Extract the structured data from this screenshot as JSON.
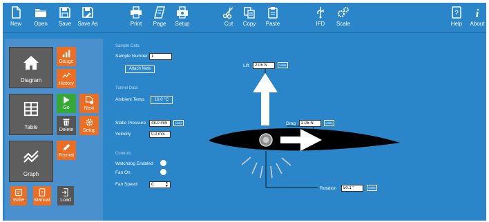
{
  "toolbar": {
    "new": "New",
    "open": "Open",
    "save": "Save",
    "save_as": "Save As",
    "print": "Print",
    "page": "Page",
    "setup": "Setup",
    "cut": "Cut",
    "copy": "Copy",
    "paste": "Paste",
    "ifd": "IFD",
    "scale": "Scale",
    "help": "Help",
    "about": "About"
  },
  "tiles": {
    "diagram": "Diagram",
    "gauge": "Gauge",
    "history": "History",
    "table": "Table",
    "go": "Go",
    "next": "Next",
    "delete": "Delete",
    "setup": "Setup",
    "graph": "Graph",
    "format": "Format",
    "write": "Write",
    "manual": "Manual",
    "load": "Load"
  },
  "sample": {
    "section": "Sample Data",
    "number_label": "Sample Number",
    "number_value": "1",
    "attach_note": "Attach Note"
  },
  "tunnel": {
    "section": "Tunnel Data",
    "ambient_label": "Ambient Temp.",
    "ambient_value": "18.0 °C"
  },
  "pressure": {
    "static_label": "Static Pressure",
    "static_value": "48.0 mm",
    "static_unit_btn": "Units",
    "velocity_label": "Velocity",
    "velocity_value": "0.0 m/s"
  },
  "controls": {
    "section": "Controls",
    "watchdog_label": "Watchdog Enabled",
    "fan_on_label": "Fan On",
    "fan_speed_label": "Fan Speed",
    "fan_speed_value": "0"
  },
  "readouts": {
    "lift_label": "Lift",
    "lift_value": "2.05 N",
    "drag_label": "Drag",
    "drag_value": "2.05 N",
    "rotation_label": "Rotation",
    "rotation_value": "50.1 °",
    "unit_btn": "Units"
  },
  "colors": {
    "background": "#2a86c8",
    "tile_orange": "#ec6e23",
    "tile_green": "#35a838",
    "tile_gray": "#5e5e5e"
  }
}
